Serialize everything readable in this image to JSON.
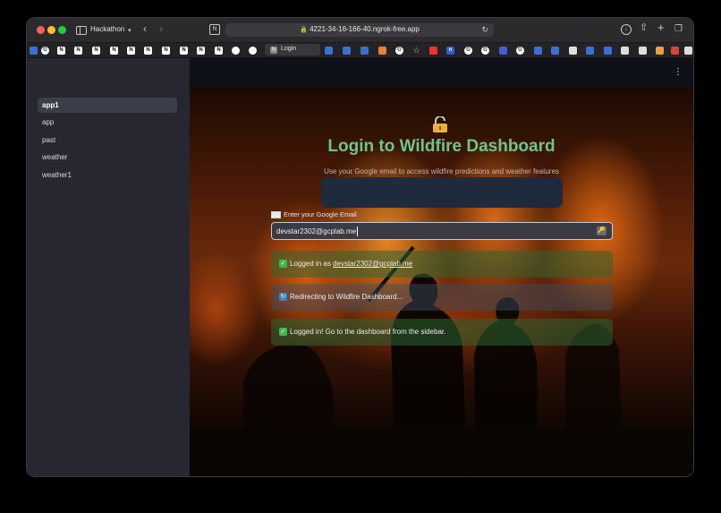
{
  "browser": {
    "tab_group": "Hackathon",
    "url": "4221-34-16-166-40.ngrok-free.app",
    "favorites_tab_label": "Login"
  },
  "sidebar": {
    "items": [
      {
        "label": "app1",
        "active": true
      },
      {
        "label": "app",
        "active": false
      },
      {
        "label": "past",
        "active": false
      },
      {
        "label": "weather",
        "active": false
      },
      {
        "label": "weather1",
        "active": false
      }
    ]
  },
  "main": {
    "title": "Login to Wildfire Dashboard",
    "subtitle": "Use your Google email to access wildfire predictions and weather features",
    "email_label": "Enter your Google Email",
    "email_value": "devstar2302@gcplab.me",
    "alerts": [
      {
        "type": "success",
        "prefix": "Logged in as ",
        "link": "devstar2302@gcplab.me",
        "suffix": ""
      },
      {
        "type": "info",
        "prefix": "Redirecting to Wildfire Dashboard...",
        "link": "",
        "suffix": ""
      },
      {
        "type": "success",
        "prefix": "Logged in! Go to the dashboard from the sidebar.",
        "link": "",
        "suffix": ""
      }
    ]
  },
  "colors": {
    "title_green": "#6ec48f",
    "sidebar_bg": "#262730",
    "app_bg": "#0e1117"
  }
}
